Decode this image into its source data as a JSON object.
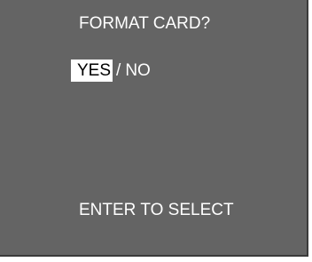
{
  "dialog": {
    "title": "FORMAT CARD?",
    "options": {
      "yes": "YES",
      "separator": "/",
      "no": "NO",
      "selected": "YES"
    },
    "hint": "ENTER TO SELECT"
  },
  "colors": {
    "background": "#646464",
    "text": "#ffffff",
    "highlight_bg": "#ffffff",
    "highlight_text": "#000000"
  }
}
